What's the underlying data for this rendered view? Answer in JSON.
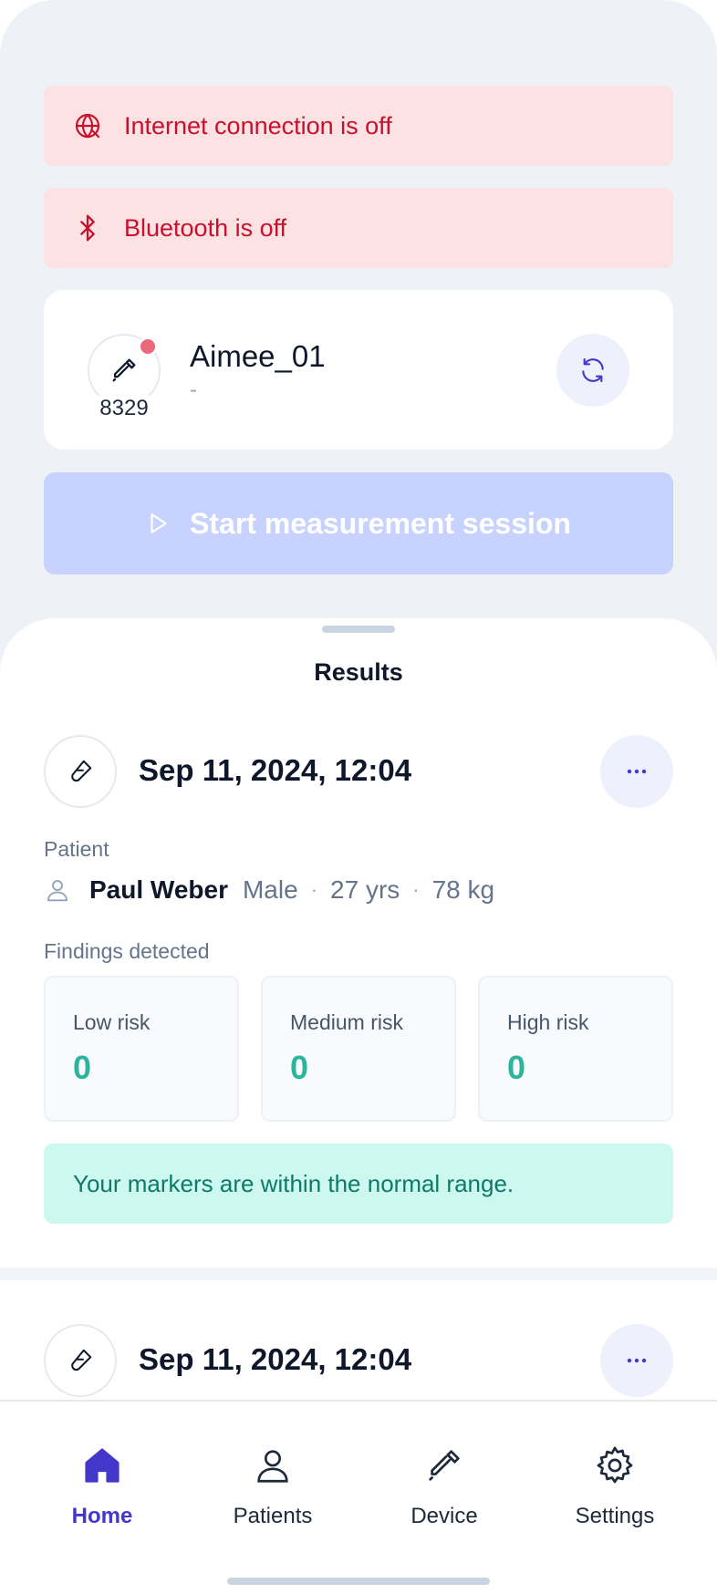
{
  "alerts": {
    "internet": "Internet connection is off",
    "bluetooth": "Bluetooth is off"
  },
  "device": {
    "code": "8329",
    "name": "Aimee_01",
    "subtitle": "-",
    "status_color": "#e86a7c"
  },
  "start_button": {
    "label": "Start measurement session"
  },
  "results": {
    "title": "Results",
    "items": [
      {
        "date": "Sep 11, 2024, 12:04",
        "patient_label": "Patient",
        "patient_name": "Paul Weber",
        "sex": "Male",
        "age": "27 yrs",
        "weight": "78 kg",
        "findings_label": "Findings detected",
        "low_label": "Low risk",
        "low_value": "0",
        "medium_label": "Medium risk",
        "medium_value": "0",
        "high_label": "High risk",
        "high_value": "0",
        "message": "Your markers are within the normal range."
      },
      {
        "date": "Sep 11, 2024, 12:04"
      }
    ]
  },
  "nav": {
    "home": "Home",
    "patients": "Patients",
    "device": "Device",
    "settings": "Settings",
    "active": "home"
  },
  "colors": {
    "accent": "#4338ca",
    "alert_bg": "#fde2e3",
    "alert_text": "#c8102e",
    "success": "#2bb59c",
    "button_disabled": "#c7d2fe"
  }
}
